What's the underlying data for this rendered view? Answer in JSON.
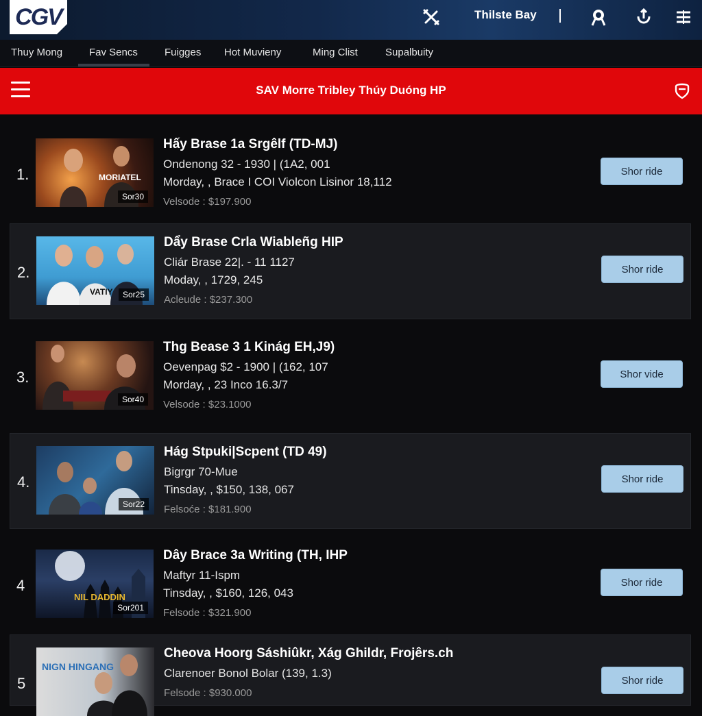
{
  "app": {
    "logo_text": "CGV",
    "header_title": "Thilste Bay"
  },
  "nav": {
    "tabs": [
      {
        "label": "Thuy Mong"
      },
      {
        "label": "Fav Sencs"
      },
      {
        "label": "Fuigges"
      },
      {
        "label": "Hot Muvieny"
      },
      {
        "label": "Ming Clist"
      },
      {
        "label": "Supalbuity"
      }
    ],
    "active_index": 1
  },
  "banner": {
    "title": "SAV Morre Tribley Thúy Duóng HP"
  },
  "colors": {
    "accent_red": "#e0070b",
    "button_bg": "#a9cde8",
    "header_bg": "#12284a"
  },
  "movies": [
    {
      "rank": "1.",
      "title": "Hấy Brase 1a Srgêlf  (TD-MJ)",
      "line1": "Ondenong 32 - 1930 | (1A2, 001",
      "line2": "Morday, , Brace I COI Violcon Lisinor  18,112",
      "price": "Velsode : $197.900",
      "badge": "Sor30",
      "poster_text": "MORIATEL",
      "button": "Shor ride"
    },
    {
      "rank": "2.",
      "title": "Dẩy Brase Crla Wiableñg HIP",
      "line1": "Cliár Brase 22|. - 11 1127",
      "line2": "Moday, , 1729, 245",
      "price": "Acleude : $237.300",
      "badge": "Sor25",
      "poster_text": "VATIY",
      "button": "Shor ride"
    },
    {
      "rank": "3.",
      "title": "Thg Bease 3 1 Kinág EH,J9)",
      "line1": "Oevenpag $2 - 1900 | (162, 107",
      "line2": "Morday, , 23 Inco 16.3/7",
      "price": "Velsode : $23.1000",
      "badge": "Sor40",
      "poster_text": "",
      "button": "Shor vide"
    },
    {
      "rank": "4.",
      "title": "Hág Stpuki|Scpent (TD 49)",
      "line1": "Bigrgr 70-Mue",
      "line2": "Tinsday, , $150, 138, 067",
      "price": "Felsoće : $181.900",
      "badge": "Sor22",
      "poster_text": "",
      "button": "Shor ride"
    },
    {
      "rank": "4",
      "title": "Dây Brace 3a Writing (TH, IHP",
      "line1": "Maftyr 11-Ispm",
      "line2": "Tinsday, , $160, 126, 043",
      "price": "Felsode : $321.900",
      "badge": "Sor201",
      "poster_text": "NIL DADDIN",
      "button": "Shor ride"
    },
    {
      "rank": "5",
      "title": "Cheova Hoorg Sáshiûkr, Xág Ghildr, Frojêrs.ch",
      "line1": "Clarenoer Bonol Bolar (139, 1.3)",
      "line2": "",
      "price": "Felsode : $930.000",
      "badge": "",
      "poster_text": "NIGN HINGANG",
      "button": "Shor ride"
    }
  ]
}
